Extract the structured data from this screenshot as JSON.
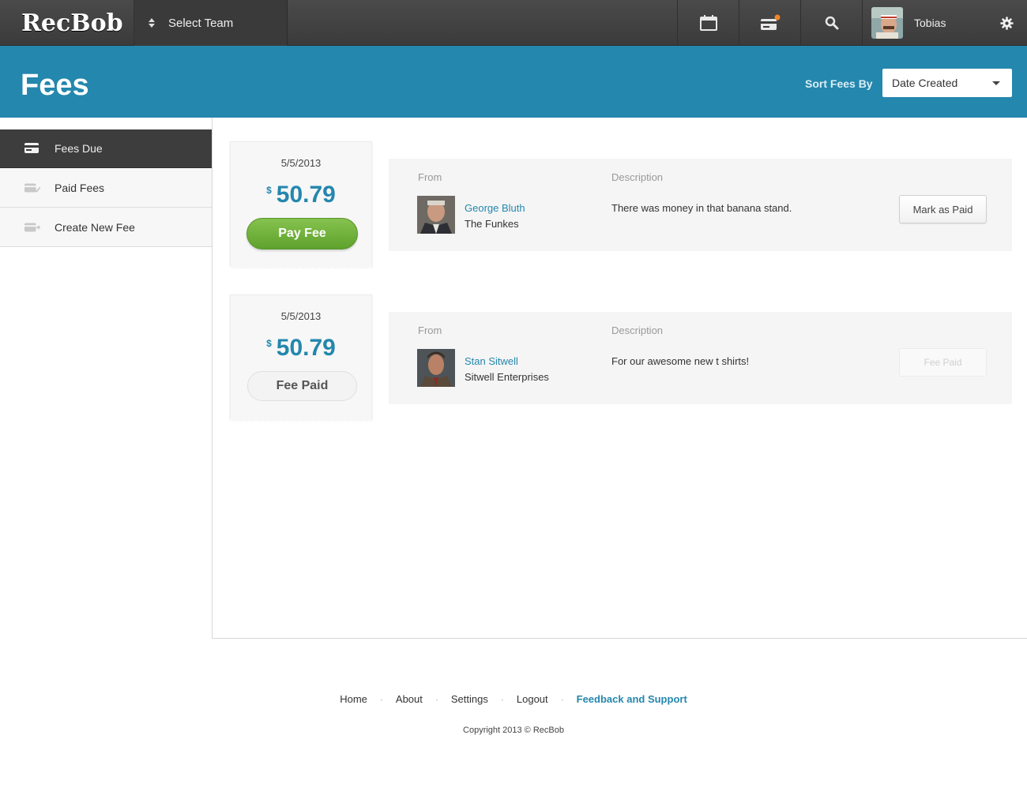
{
  "app": {
    "logo": "RecBob"
  },
  "topbar": {
    "team_select_label": "Select Team",
    "user_name": "Tobias",
    "notification_color": "#f0862a"
  },
  "header": {
    "title": "Fees",
    "sort_label": "Sort Fees By",
    "sort_value": "Date Created"
  },
  "sidebar": {
    "items": [
      {
        "label": "Fees Due",
        "icon": "card-icon",
        "active": true
      },
      {
        "label": "Paid Fees",
        "icon": "card-check-icon",
        "active": false
      },
      {
        "label": "Create New Fee",
        "icon": "card-plus-icon",
        "active": false
      }
    ]
  },
  "fees": [
    {
      "date": "5/5/2013",
      "currency": "$",
      "amount": "50.79",
      "action_label": "Pay Fee",
      "from_label": "From",
      "description_label": "Description",
      "person_name": "George Bluth",
      "person_org": "The Funkes",
      "description": "There was money in that banana stand.",
      "status_button": "Mark as Paid"
    },
    {
      "date": "5/5/2013",
      "currency": "$",
      "amount": "50.79",
      "action_label": "Fee Paid",
      "from_label": "From",
      "description_label": "Description",
      "person_name": "Stan Sitwell",
      "person_org": "Sitwell Enterprises",
      "description": "For our awesome new t shirts!",
      "status_button": "Fee Paid"
    }
  ],
  "footer": {
    "links": [
      "Home",
      "About",
      "Settings",
      "Logout"
    ],
    "feedback": "Feedback and Support",
    "copyright": "Copyright 2013 © RecBob"
  },
  "colors": {
    "accent": "#2487ad",
    "pay_green": "#6fb23a",
    "topbar": "#3f3f3f"
  }
}
